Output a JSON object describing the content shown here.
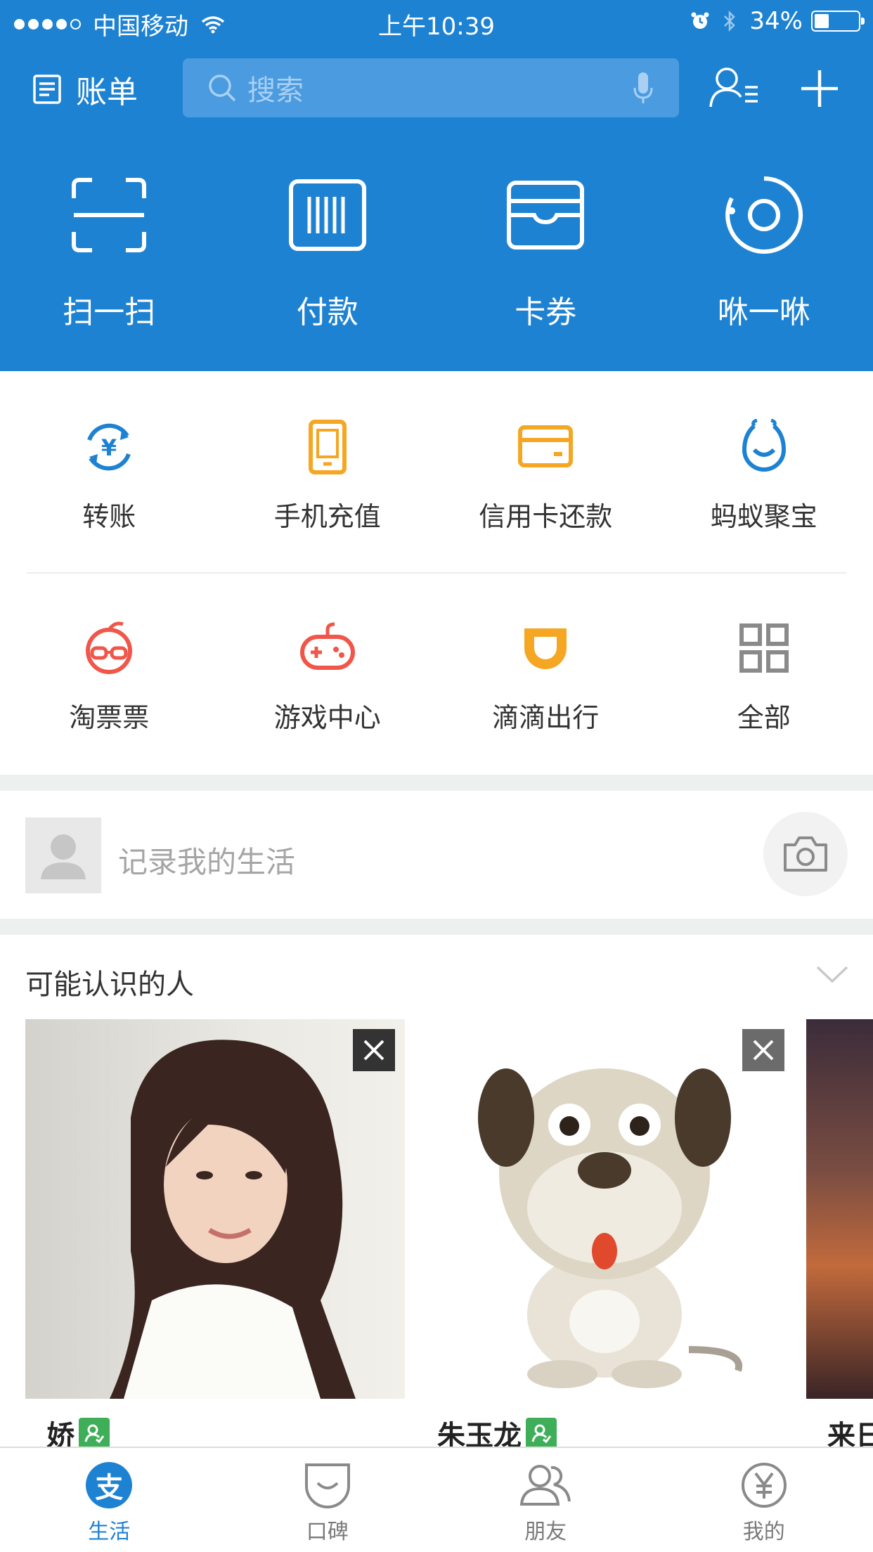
{
  "status_bar": {
    "carrier": "中国移动",
    "time": "上午10:39",
    "battery": "34%",
    "battery_level": 0.34,
    "signal_bars": 4
  },
  "header": {
    "bill_label": "账单",
    "search_placeholder": "搜索",
    "icons": [
      "bill-icon",
      "search-icon",
      "mic-icon",
      "contacts-icon",
      "add-icon"
    ]
  },
  "hero": [
    {
      "label": "扫一扫",
      "icon": "scan-icon"
    },
    {
      "label": "付款",
      "icon": "barcode-icon"
    },
    {
      "label": "卡券",
      "icon": "wallet-icon"
    },
    {
      "label": "咻一咻",
      "icon": "xiu-icon"
    }
  ],
  "services_row1": [
    {
      "label": "转账",
      "icon": "transfer-icon"
    },
    {
      "label": "手机充值",
      "icon": "phone-icon"
    },
    {
      "label": "信用卡还款",
      "icon": "credit-card-icon"
    },
    {
      "label": "蚂蚁聚宝",
      "icon": "ant-fortune-icon"
    }
  ],
  "services_row2": [
    {
      "label": "淘票票",
      "icon": "taopiaopiao-icon"
    },
    {
      "label": "游戏中心",
      "icon": "gamepad-icon"
    },
    {
      "label": "滴滴出行",
      "icon": "didi-icon"
    },
    {
      "label": "全部",
      "icon": "grid-icon"
    }
  ],
  "record": {
    "placeholder": "记录我的生活"
  },
  "people": {
    "title": "可能认识的人",
    "cards": [
      {
        "name": "娇"
      },
      {
        "name": "朱玉龙"
      },
      {
        "name": "来日"
      }
    ]
  },
  "tabbar": [
    {
      "label": "生活",
      "active": true,
      "glyph": "支"
    },
    {
      "label": "口碑",
      "active": false
    },
    {
      "label": "朋友",
      "active": false
    },
    {
      "label": "我的",
      "active": false
    }
  ],
  "colors": {
    "brand_blue": "#1e82d2",
    "orange": "#f5a623",
    "red": "#f0564a",
    "verified_green": "#3fae59"
  }
}
